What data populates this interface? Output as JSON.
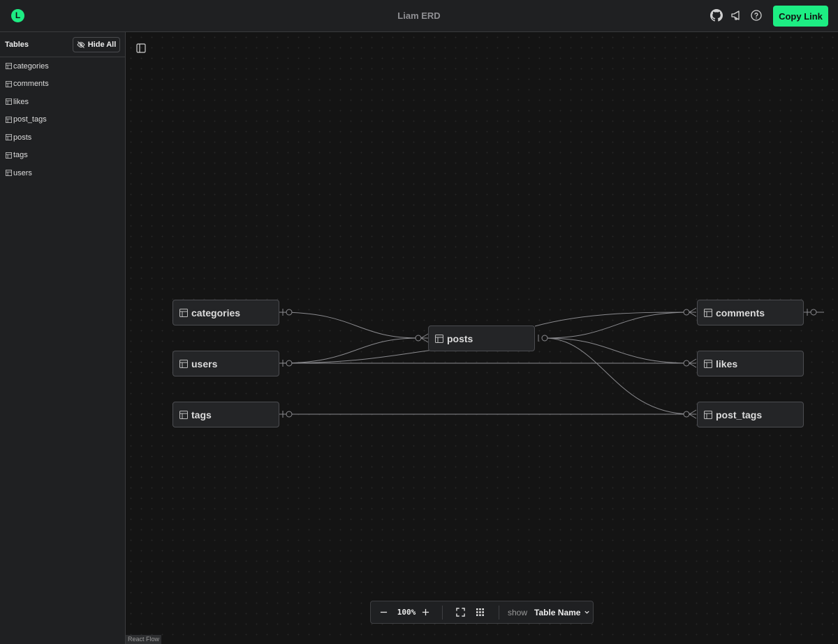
{
  "header": {
    "logo_letter": "L",
    "title": "Liam ERD",
    "copy_link_label": "Copy Link",
    "icons": [
      "github-icon",
      "megaphone-icon",
      "help-icon"
    ],
    "accent_color": "#1ded83"
  },
  "sidebar": {
    "title": "Tables",
    "hide_all_label": "Hide All",
    "items": [
      "categories",
      "comments",
      "likes",
      "post_tags",
      "posts",
      "tags",
      "users"
    ]
  },
  "canvas": {
    "nodes": {
      "categories": "categories",
      "users": "users",
      "tags": "tags",
      "posts": "posts",
      "comments": "comments",
      "likes": "likes",
      "post_tags": "post_tags"
    },
    "attribution": "React Flow"
  },
  "toolbar": {
    "zoom": "100%",
    "show_label": "show",
    "show_value": "Table Name"
  }
}
